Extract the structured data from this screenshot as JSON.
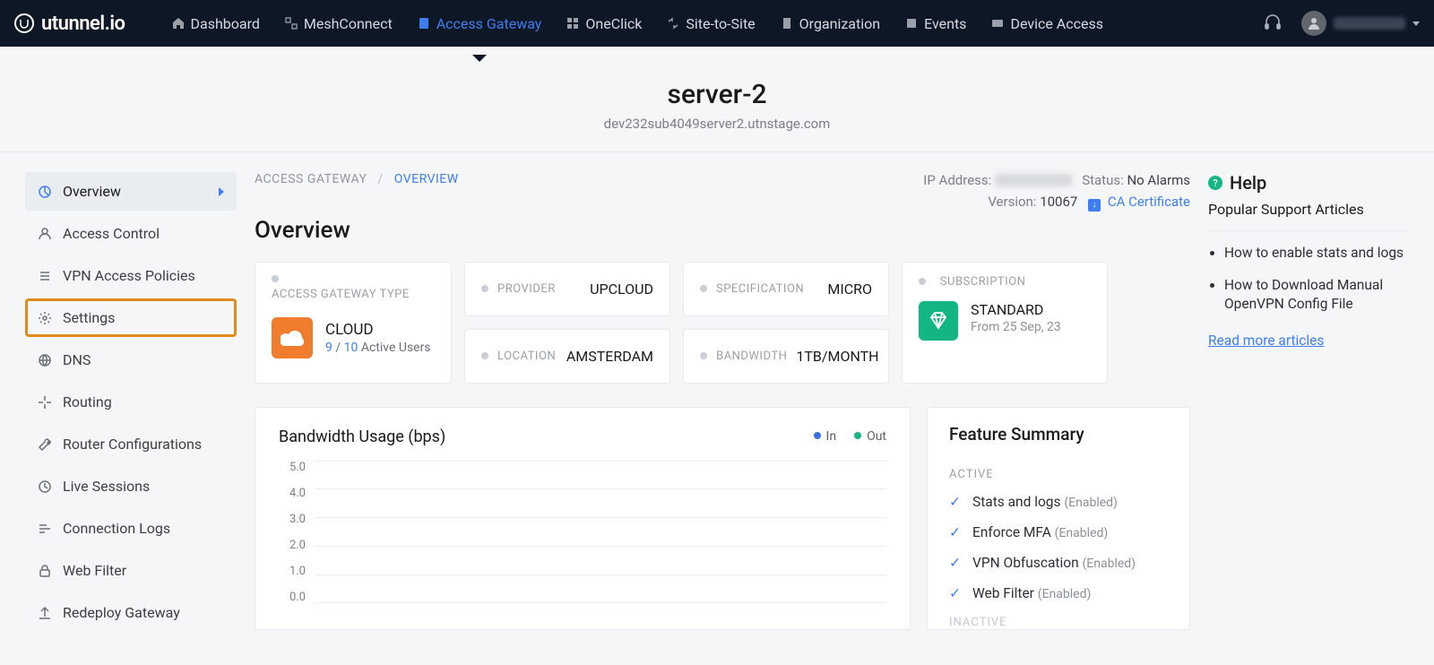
{
  "brand": "utunnel.io",
  "nav": {
    "items": [
      {
        "label": "Dashboard",
        "active": false
      },
      {
        "label": "MeshConnect",
        "active": false
      },
      {
        "label": "Access Gateway",
        "active": true
      },
      {
        "label": "OneClick",
        "active": false
      },
      {
        "label": "Site-to-Site",
        "active": false
      },
      {
        "label": "Organization",
        "active": false
      },
      {
        "label": "Events",
        "active": false
      },
      {
        "label": "Device Access",
        "active": false
      }
    ]
  },
  "page": {
    "title": "server-2",
    "hostname": "dev232sub4049server2.utnstage.com"
  },
  "sidebar": {
    "items": [
      {
        "label": "Overview",
        "active": true,
        "highlight": false,
        "icon": "pie"
      },
      {
        "label": "Access Control",
        "active": false,
        "highlight": false,
        "icon": "user"
      },
      {
        "label": "VPN Access Policies",
        "active": false,
        "highlight": false,
        "icon": "list"
      },
      {
        "label": "Settings",
        "active": false,
        "highlight": true,
        "icon": "gear"
      },
      {
        "label": "DNS",
        "active": false,
        "highlight": false,
        "icon": "globe"
      },
      {
        "label": "Routing",
        "active": false,
        "highlight": false,
        "icon": "crosshair"
      },
      {
        "label": "Router Configurations",
        "active": false,
        "highlight": false,
        "icon": "wrench"
      },
      {
        "label": "Live Sessions",
        "active": false,
        "highlight": false,
        "icon": "clock"
      },
      {
        "label": "Connection Logs",
        "active": false,
        "highlight": false,
        "icon": "lines"
      },
      {
        "label": "Web Filter",
        "active": false,
        "highlight": false,
        "icon": "lock"
      },
      {
        "label": "Redeploy Gateway",
        "active": false,
        "highlight": false,
        "icon": "upload"
      }
    ]
  },
  "breadcrumb": {
    "root": "ACCESS GATEWAY",
    "current": "OVERVIEW"
  },
  "heading": "Overview",
  "status": {
    "ip_label": "IP Address:",
    "ip_value": "",
    "status_label": "Status:",
    "status_value": "No Alarms",
    "version_label": "Version:",
    "version_value": "10067",
    "ca_cert": "CA Certificate"
  },
  "cards": {
    "gateway_type": {
      "label": "ACCESS GATEWAY TYPE",
      "value": "CLOUD",
      "users_current": "9",
      "users_max": "10",
      "users_suffix": "Active Users"
    },
    "provider": {
      "label": "PROVIDER",
      "value": "UPCLOUD"
    },
    "location": {
      "label": "LOCATION",
      "value": "AMSTERDAM"
    },
    "spec": {
      "label": "SPECIFICATION",
      "value": "MICRO"
    },
    "bandwidth": {
      "label": "BANDWIDTH",
      "value": "1TB/MONTH"
    },
    "subscription": {
      "label": "SUBSCRIPTION",
      "value": "STANDARD",
      "from": "From 25 Sep, 23"
    }
  },
  "chart_data": {
    "type": "line",
    "title": "Bandwidth Usage (bps)",
    "series": [
      {
        "name": "In",
        "color": "#3b6fe0",
        "values": []
      },
      {
        "name": "Out",
        "color": "#13b682",
        "values": []
      }
    ],
    "ylabel": "bps",
    "ylim": [
      0,
      5
    ],
    "yticks": [
      "5.0",
      "4.0",
      "3.0",
      "2.0",
      "1.0",
      "0.0"
    ]
  },
  "features": {
    "title": "Feature Summary",
    "active_label": "ACTIVE",
    "inactive_label": "INACTIVE",
    "active": [
      {
        "name": "Stats and logs",
        "state": "(Enabled)"
      },
      {
        "name": "Enforce MFA",
        "state": "(Enabled)"
      },
      {
        "name": "VPN Obfuscation",
        "state": "(Enabled)"
      },
      {
        "name": "Web Filter",
        "state": "(Enabled)"
      }
    ]
  },
  "help": {
    "title": "Help",
    "subtitle": "Popular Support Articles",
    "articles": [
      "How to enable stats and logs",
      "How to Download Manual OpenVPN Config File"
    ],
    "more": "Read more articles"
  }
}
